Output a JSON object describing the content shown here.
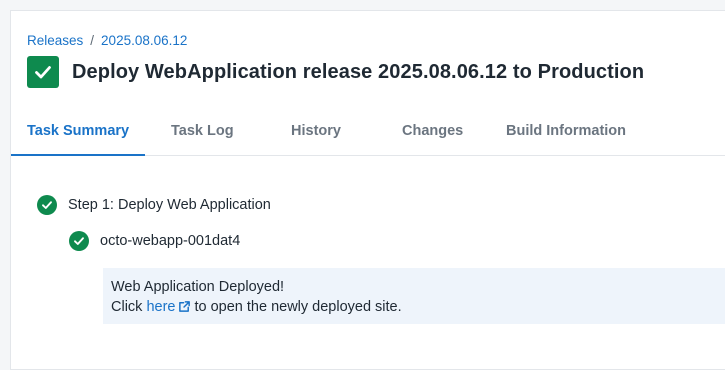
{
  "breadcrumb": {
    "root": "Releases",
    "separator": "/",
    "current": "2025.08.06.12"
  },
  "header": {
    "title": "Deploy WebApplication release 2025.08.06.12 to Production",
    "status_icon": "check-icon",
    "status_color": "#0e8a4e"
  },
  "tabs": [
    {
      "label": "Task Summary",
      "active": true
    },
    {
      "label": "Task Log",
      "active": false
    },
    {
      "label": "History",
      "active": false
    },
    {
      "label": "Changes",
      "active": false
    },
    {
      "label": "Build Information",
      "active": false
    }
  ],
  "summary": {
    "step": {
      "label": "Step 1: Deploy Web Application",
      "status": "success"
    },
    "target": {
      "label": "octo-webapp-001dat4",
      "status": "success"
    },
    "message": {
      "line1": "Web Application Deployed!",
      "prefix": "Click",
      "link": "here",
      "suffix": "to open the newly deployed site."
    }
  },
  "colors": {
    "accent": "#1a73c8",
    "success": "#0e8a4e",
    "message_bg": "#eef4fb"
  }
}
